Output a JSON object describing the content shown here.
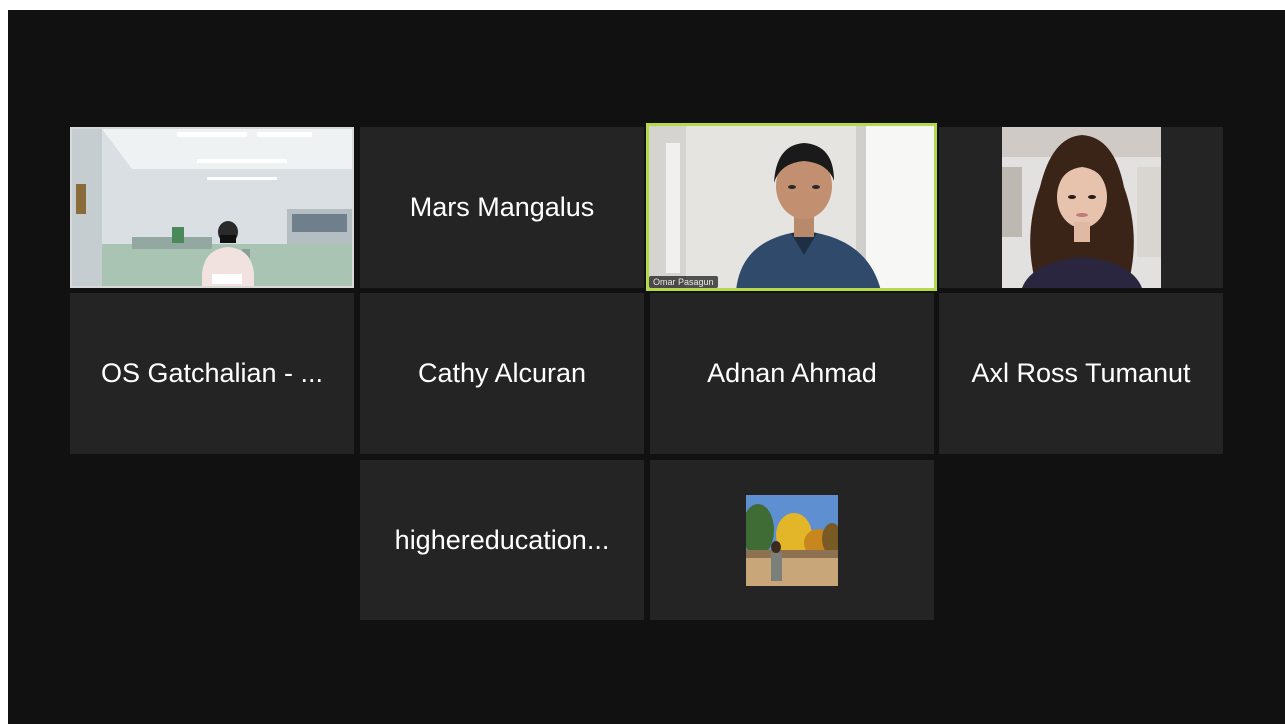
{
  "app": {
    "accent_color": "#b6d94a",
    "tile_color": "#242424",
    "background_color": "#111111"
  },
  "participants": [
    {
      "name": "",
      "video": true,
      "scene": "office"
    },
    {
      "name": "Mars Mangalus",
      "video": false
    },
    {
      "name": "",
      "video": true,
      "active_speaker": true,
      "video_label": "Omar Pasagun",
      "scene": "man-blue-shirt"
    },
    {
      "name": "",
      "video": true,
      "scene": "woman-long-hair"
    },
    {
      "name": "OS Gatchalian - ...",
      "video": false
    },
    {
      "name": "Cathy Alcuran",
      "video": false
    },
    {
      "name": "Adnan Ahmad",
      "video": false
    },
    {
      "name": "Axl Ross Tumanut",
      "video": false
    },
    {
      "name": "highereducation...",
      "video": false
    },
    {
      "name": "",
      "video": false,
      "avatar": "profile-photo-autumn-trees"
    }
  ]
}
